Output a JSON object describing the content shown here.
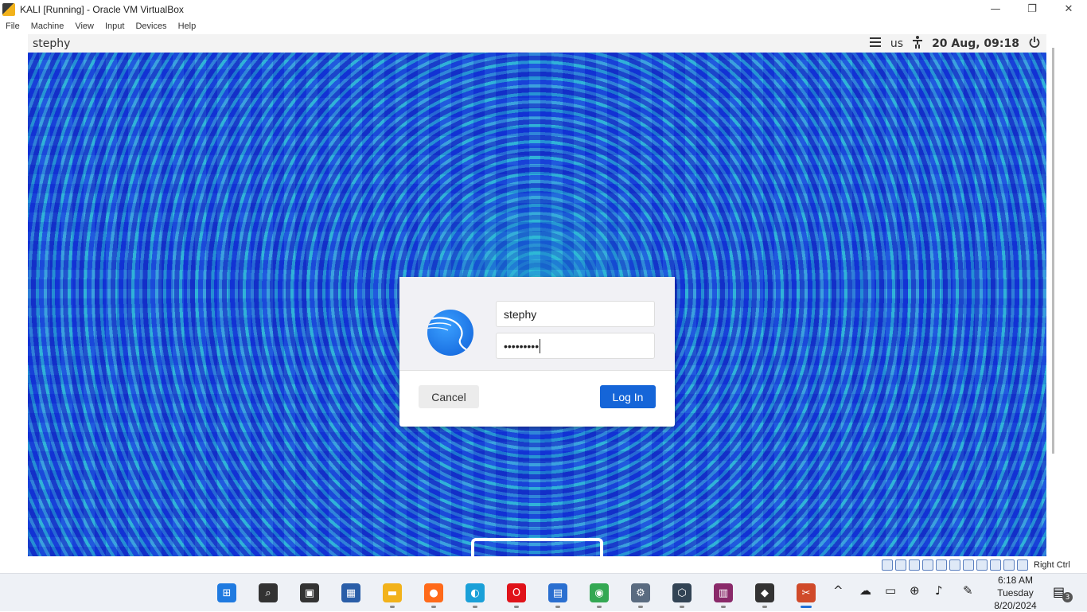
{
  "window": {
    "title": "KALI [Running] - Oracle VM VirtualBox",
    "controls": [
      "—",
      "❐",
      "✕"
    ]
  },
  "menubar": [
    "File",
    "Machine",
    "View",
    "Input",
    "Devices",
    "Help"
  ],
  "guest_topbar": {
    "user": "stephy",
    "keyboard_layout": "us",
    "datetime": "20 Aug, 09:18",
    "menu_icon": "hamburger-icon",
    "accessibility_icon": "accessibility-icon",
    "power_icon": "power-icon"
  },
  "login": {
    "username": "stephy",
    "password_masked": "•••••••••",
    "cancel_label": "Cancel",
    "login_label": "Log In",
    "accent": "#1565d8"
  },
  "vbox_status": {
    "host_key": "Right Ctrl",
    "icons": [
      "hdd-icon",
      "optical-icon",
      "audio-icon",
      "network-icon",
      "usb-icon",
      "shared-folder-icon",
      "display-icon",
      "recording-icon",
      "cpu-icon",
      "mouse-integration-icon",
      "keyboard-icon"
    ]
  },
  "taskbar": {
    "apps": [
      {
        "name": "start-icon",
        "color": "#1f7ae0",
        "glyph": "⊞"
      },
      {
        "name": "search-icon",
        "color": "#333333",
        "glyph": "⌕"
      },
      {
        "name": "task-view-icon",
        "color": "#333333",
        "glyph": "▣"
      },
      {
        "name": "widgets-icon",
        "color": "#2a5ea8",
        "glyph": "▦"
      },
      {
        "name": "file-explorer-icon",
        "color": "#f2b21b",
        "glyph": "▬"
      },
      {
        "name": "firefox-icon",
        "color": "#ff6a1a",
        "glyph": "●"
      },
      {
        "name": "edge-icon",
        "color": "#1aa0d8",
        "glyph": "◐"
      },
      {
        "name": "opera-icon",
        "color": "#e0131a",
        "glyph": "O"
      },
      {
        "name": "store-icon",
        "color": "#2a6fd0",
        "glyph": "▤"
      },
      {
        "name": "chrome-icon",
        "color": "#34a853",
        "glyph": "◉"
      },
      {
        "name": "settings-icon",
        "color": "#5a6b80",
        "glyph": "⚙"
      },
      {
        "name": "vmware-icon",
        "color": "#334455",
        "glyph": "⬡"
      },
      {
        "name": "winrar-icon",
        "color": "#8a2a6a",
        "glyph": "▥"
      },
      {
        "name": "virtualbox-icon",
        "color": "#333333",
        "glyph": "◆"
      },
      {
        "name": "snipping-tool-icon",
        "color": "#d04a2a",
        "glyph": "✂"
      }
    ],
    "tray": {
      "chevron": "^",
      "icons": [
        "cloud-icon",
        "battery-icon",
        "globe-icon",
        "volume-icon",
        "pen-icon"
      ]
    },
    "time": "6:18 AM",
    "day": "Tuesday",
    "date": "8/20/2024",
    "notification_count": "3"
  }
}
